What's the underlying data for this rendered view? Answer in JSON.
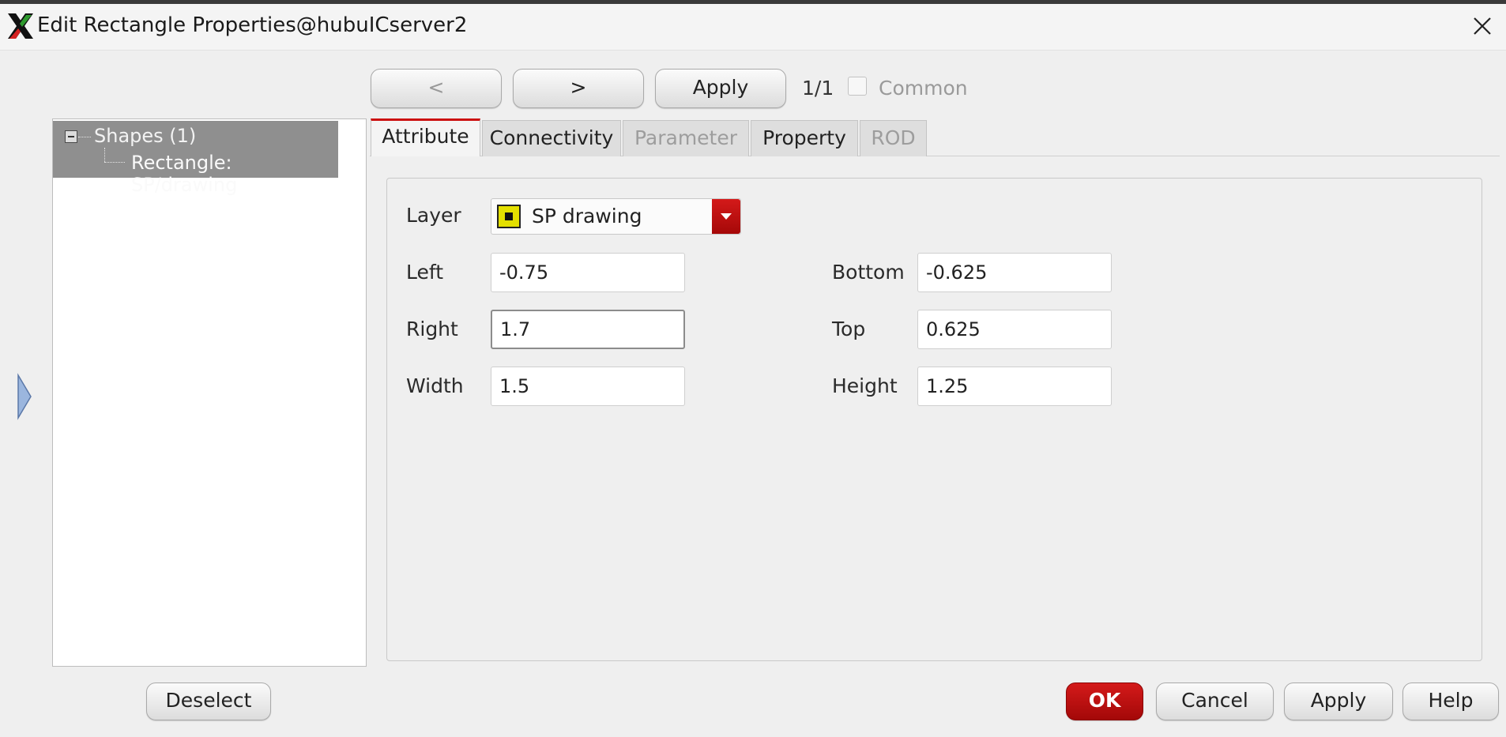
{
  "window": {
    "title": "Edit Rectangle Properties@hubuICserver2"
  },
  "nav": {
    "prev_label": "<",
    "next_label": ">",
    "apply_label": "Apply",
    "counter": "1/1",
    "common_label": "Common",
    "common_checked": false
  },
  "tree": {
    "root_label": "Shapes (1)",
    "child_label": "Rectangle: SP/drawing"
  },
  "tabs": [
    {
      "label": "Attribute",
      "active": true,
      "enabled": true
    },
    {
      "label": "Connectivity",
      "active": false,
      "enabled": true
    },
    {
      "label": "Parameter",
      "active": false,
      "enabled": false
    },
    {
      "label": "Property",
      "active": false,
      "enabled": true
    },
    {
      "label": "ROD",
      "active": false,
      "enabled": false
    }
  ],
  "attribute": {
    "layer_label": "Layer",
    "layer_value": "SP drawing",
    "layer_color": "#e4e000",
    "left_label": "Left",
    "left_value": "-0.75",
    "right_label": "Right",
    "right_value": "1.7",
    "width_label": "Width",
    "width_value": "1.5",
    "bottom_label": "Bottom",
    "bottom_value": "-0.625",
    "top_label": "Top",
    "top_value": "0.625",
    "height_label": "Height",
    "height_value": "1.25"
  },
  "footer": {
    "deselect_label": "Deselect",
    "ok_label": "OK",
    "cancel_label": "Cancel",
    "apply_label": "Apply",
    "help_label": "Help"
  },
  "colors": {
    "accent": "#cc1111",
    "selection": "#8f8f8f"
  }
}
